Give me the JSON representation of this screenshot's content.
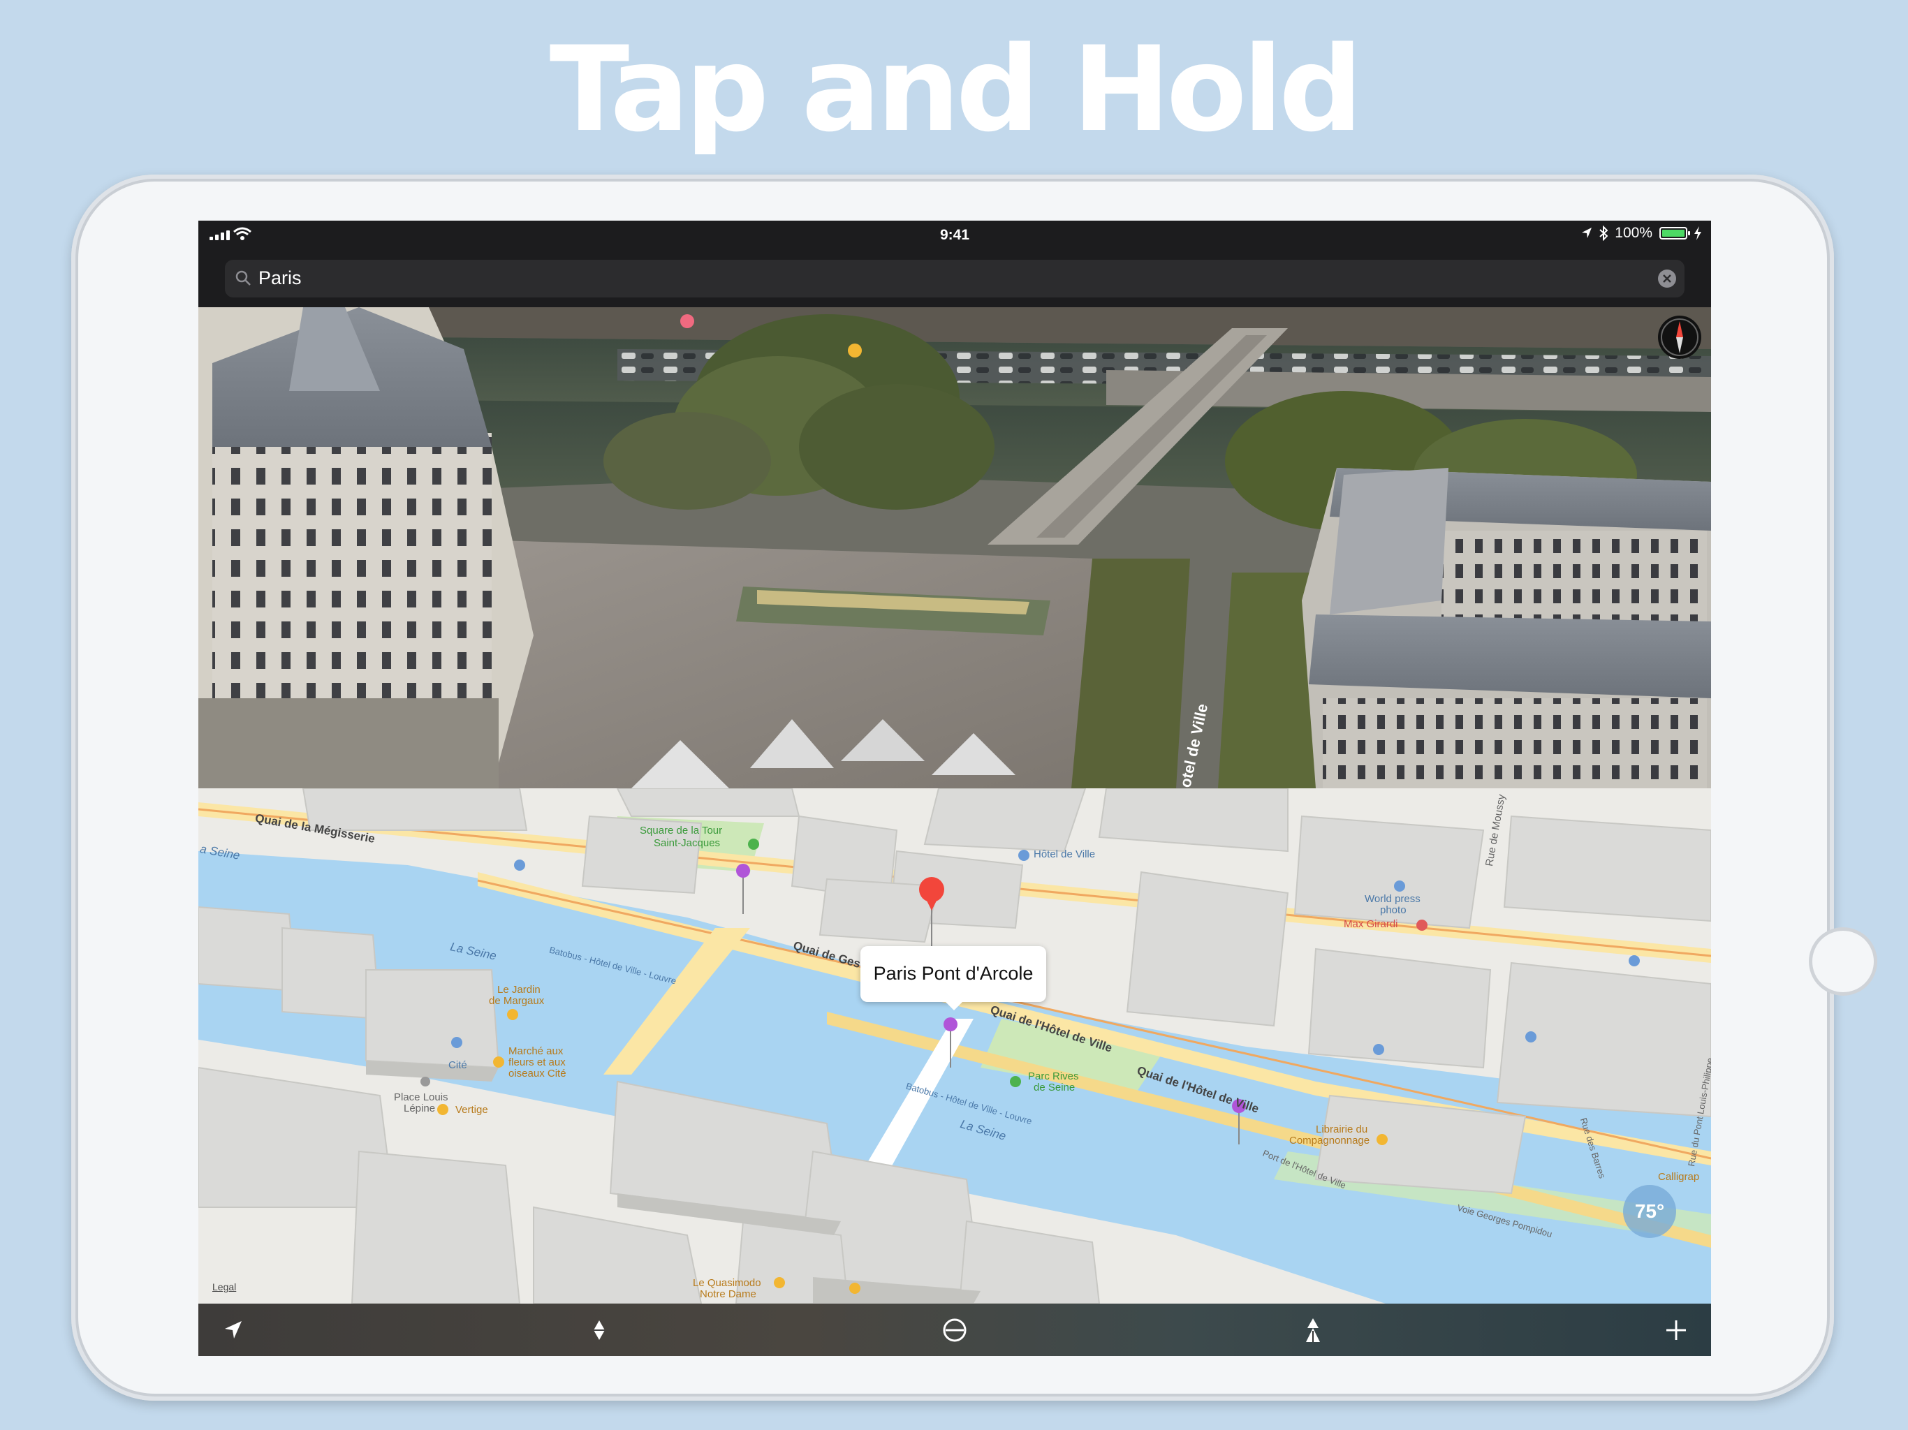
{
  "headline": "Tap and Hold",
  "status_bar": {
    "time": "9:41",
    "battery": "100%",
    "battery_level": 1.0
  },
  "search": {
    "value": "Paris"
  },
  "map": {
    "callout": "Paris Pont d'Arcole",
    "temperature": "75°",
    "legal": "Legal",
    "labels": {
      "quai_megisserie": "Quai de la Mégisserie",
      "square_line1": "Square de la Tour",
      "square_line2": "Saint-Jacques",
      "hotel_de_ville": "Hôtel de Ville",
      "world_press_line1": "World press",
      "world_press_line2": "photo",
      "rue_moussy": "Rue de Moussy",
      "max_girardi": "Max Girardi",
      "a_seine": "a Seine",
      "la_seine_1": "La Seine",
      "batobus_1": "Batobus - Hôtel de Ville - Louvre",
      "quai_gesvres": "Quai de Gesv",
      "quai_hotel_1": "Quai de l'Hôtel de Ville",
      "le_jardin_line1": "Le Jardin",
      "le_jardin_line2": "de Margaux",
      "cite": "Cité",
      "marche_line1": "Marché aux",
      "marche_line2": "fleurs et aux",
      "marche_line3": "oiseaux Cité",
      "parc_line1": "Parc Rives",
      "parc_line2": "de Seine",
      "quai_hotel_2": "Quai de l'Hôtel de Ville",
      "batobus_2": "Batobus - Hôtel de Ville - Louvre",
      "la_seine_2": "La Seine",
      "place_louis_line1": "Place Louis",
      "place_louis_line2": "Lépine",
      "vertige": "Vertige",
      "librairie_line1": "Librairie du",
      "librairie_line2": "Compagnonnage",
      "port_hotel": "Port de l'Hôtel de Ville",
      "voie_pompidou": "Voie Georges Pompidou",
      "rue_barres": "Rue des Barres",
      "rue_louis_philippe": "Rue du Pont Louis-Philippe",
      "calligrap": "Calligrap",
      "le_quasimodo_line1": "Le Quasimodo",
      "le_quasimodo_line2": "Notre Dame",
      "street_photo": "otel de Ville"
    }
  },
  "colors": {
    "background": "#c3d9ec",
    "water": "#a9d4f2",
    "park": "#cde8b8",
    "road": "#fbe6a5",
    "pin_red": "#f2463b",
    "pin_purple": "#b055d8"
  },
  "icons": {
    "location": "location-arrow-icon",
    "flyover": "flyover-diamond-icon",
    "globe": "globe-icon",
    "person": "person-icon",
    "plus": "plus-icon"
  }
}
